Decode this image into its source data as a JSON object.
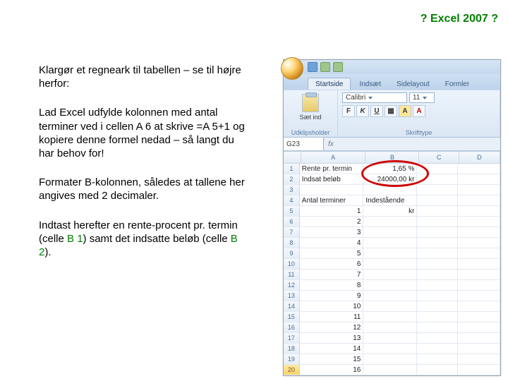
{
  "title": "? Excel 2007 ?",
  "left": {
    "p1": "Klargør et regneark til tabellen – se til højre herfor:",
    "p2": "Lad Excel udfylde kolonnen med antal terminer ved i cellen A 6 at skrive =A 5+1 og kopiere denne formel nedad – så langt du har behov for!",
    "p3": "Formater B-kolonnen, således at tallene her angives med 2 decimaler.",
    "p4a": "Indtast herefter en rente-procent pr. termin (celle ",
    "p4b": ") samt det indsatte beløb (celle ",
    "p4c": ").",
    "cB1": "B 1",
    "cB2": "B 2"
  },
  "excel": {
    "tabs": [
      "Startside",
      "Indsæt",
      "Sidelayout",
      "Formler"
    ],
    "ribbon": {
      "paste": "Sæt ind",
      "clipboard_group": "Udklipsholder",
      "font_name": "Calibri",
      "font_size": "11",
      "font_group": "Skrifttype",
      "bold": "F",
      "italic": "K",
      "underline": "U"
    },
    "namebox": "G23",
    "cols": [
      "A",
      "B",
      "C",
      "D"
    ],
    "rows": [
      {
        "n": "1",
        "A": "Rente pr. termin",
        "B": "1,65 %"
      },
      {
        "n": "2",
        "A": "Indsat beløb",
        "B": "24000,00 kr"
      },
      {
        "n": "3",
        "A": "",
        "B": ""
      },
      {
        "n": "4",
        "A": "Antal terminer",
        "B": "Indestående"
      },
      {
        "n": "5",
        "A": "1",
        "B": "kr"
      },
      {
        "n": "6",
        "A": "2",
        "B": ""
      },
      {
        "n": "7",
        "A": "3",
        "B": ""
      },
      {
        "n": "8",
        "A": "4",
        "B": ""
      },
      {
        "n": "9",
        "A": "5",
        "B": ""
      },
      {
        "n": "10",
        "A": "6",
        "B": ""
      },
      {
        "n": "11",
        "A": "7",
        "B": ""
      },
      {
        "n": "12",
        "A": "8",
        "B": ""
      },
      {
        "n": "13",
        "A": "9",
        "B": ""
      },
      {
        "n": "14",
        "A": "10",
        "B": ""
      },
      {
        "n": "15",
        "A": "11",
        "B": ""
      },
      {
        "n": "16",
        "A": "12",
        "B": ""
      },
      {
        "n": "17",
        "A": "13",
        "B": ""
      },
      {
        "n": "18",
        "A": "14",
        "B": ""
      },
      {
        "n": "19",
        "A": "15",
        "B": ""
      },
      {
        "n": "20",
        "A": "16",
        "B": ""
      }
    ]
  }
}
